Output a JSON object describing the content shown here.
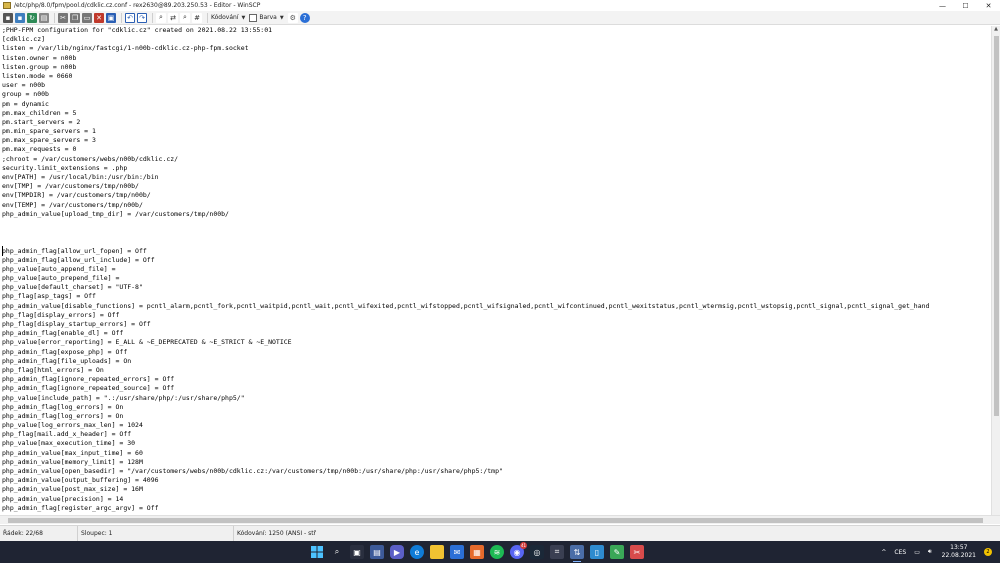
{
  "window": {
    "title": "/etc/php/8.0/fpm/pool.d/cdklic.cz.conf - rex2630@89.203.250.53 - Editor - WinSCP",
    "minimize": "—",
    "maximize": "☐",
    "close": "✕"
  },
  "toolbar": {
    "encoding_label": "Kódování",
    "color_label": "Barva"
  },
  "editor": {
    "lines": [
      ";PHP-FPM configuration for \"cdklic.cz\" created on 2021.08.22 13:55:01",
      "[cdklic.cz]",
      "listen = /var/lib/nginx/fastcgi/1-n00b-cdklic.cz-php-fpm.socket",
      "listen.owner = n00b",
      "listen.group = n00b",
      "listen.mode = 0660",
      "user = n00b",
      "group = n00b",
      "pm = dynamic",
      "pm.max_children = 5",
      "pm.start_servers = 2",
      "pm.min_spare_servers = 1",
      "pm.max_spare_servers = 3",
      "pm.max_requests = 0",
      ";chroot = /var/customers/webs/n00b/cdklic.cz/",
      "security.limit_extensions = .php",
      "env[PATH] = /usr/local/bin:/usr/bin:/bin",
      "env[TMP] = /var/customers/tmp/n00b/",
      "env[TMPDIR] = /var/customers/tmp/n00b/",
      "env[TEMP] = /var/customers/tmp/n00b/",
      "php_admin_value[upload_tmp_dir] = /var/customers/tmp/n00b/",
      "",
      "",
      "",
      "php_admin_flag[allow_url_fopen] = Off",
      "php_admin_flag[allow_url_include] = Off",
      "php_value[auto_append_file] =",
      "php_value[auto_prepend_file] =",
      "php_value[default_charset] = \"UTF-8\"",
      "php_flag[asp_tags] = Off",
      "php_admin_value[disable_functions] = pcntl_alarm,pcntl_fork,pcntl_waitpid,pcntl_wait,pcntl_wifexited,pcntl_wifstopped,pcntl_wifsignaled,pcntl_wifcontinued,pcntl_wexitstatus,pcntl_wtermsig,pcntl_wstopsig,pcntl_signal,pcntl_signal_get_hand",
      "php_flag[display_errors] = Off",
      "php_flag[display_startup_errors] = Off",
      "php_admin_flag[enable_dl] = Off",
      "php_value[error_reporting] = E_ALL & ~E_DEPRECATED & ~E_STRICT & ~E_NOTICE",
      "php_admin_flag[expose_php] = Off",
      "php_admin_flag[file_uploads] = On",
      "php_flag[html_errors] = On",
      "php_admin_flag[ignore_repeated_errors] = Off",
      "php_admin_flag[ignore_repeated_source] = Off",
      "php_value[include_path] = \".:/usr/share/php/:/usr/share/php5/\"",
      "php_admin_flag[log_errors] = On",
      "php_admin_flag[log_errors] = On",
      "php_value[log_errors_max_len] = 1024",
      "php_flag[mail.add_x_header] = Off",
      "php_value[max_execution_time] = 30",
      "php_admin_value[max_input_time] = 60",
      "php_admin_value[memory_limit] = 128M",
      "php_admin_value[open_basedir] = \"/var/customers/webs/n00b/cdklic.cz:/var/customers/tmp/n00b:/usr/share/php:/usr/share/php5:/tmp\"",
      "php_admin_value[output_buffering] = 4096",
      "php_admin_value[post_max_size] = 16M",
      "php_admin_value[precision] = 14",
      "php_admin_flag[register_argc_argv] = Off"
    ]
  },
  "statusbar": {
    "line": "Řádek: 22/68",
    "column": "Sloupec: 1",
    "encoding": "Kódování: 1250  (ANSI - stř"
  },
  "taskbar": {
    "language": "CES",
    "time": "13:57",
    "date": "22.08.2021",
    "notification_count": "2",
    "app_badge": "41"
  }
}
